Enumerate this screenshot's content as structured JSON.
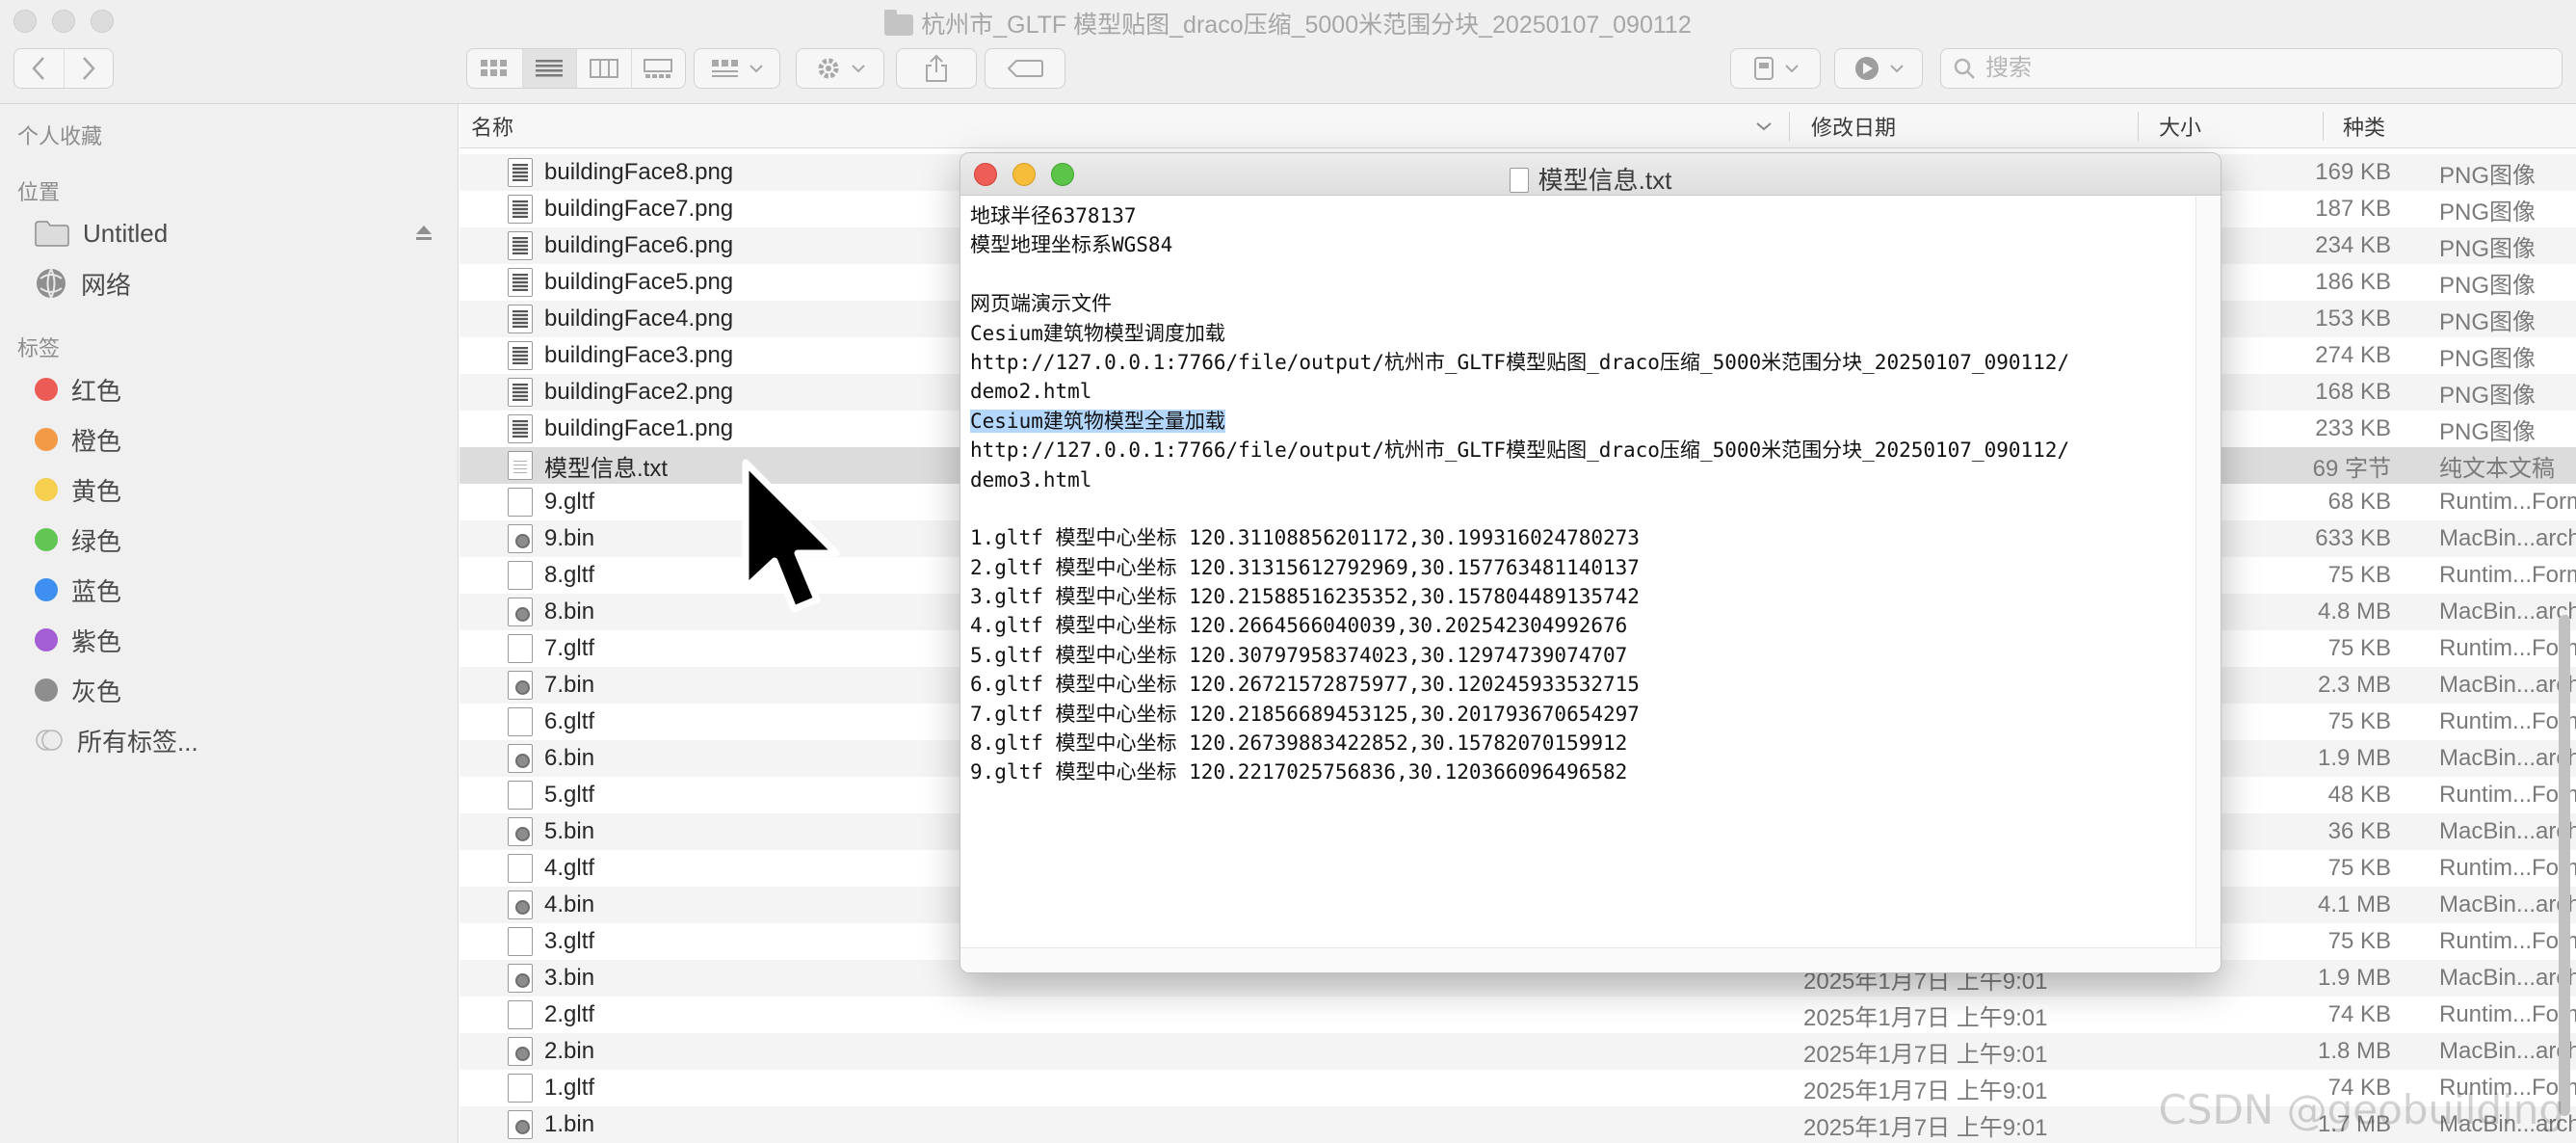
{
  "window": {
    "title": "杭州市_GLTF 模型贴图_draco压缩_5000米范围分块_20250107_090112"
  },
  "toolbar": {
    "search_placeholder": "搜索",
    "icons": [
      "back-icon",
      "forward-icon",
      "icon-view-icon",
      "list-view-icon",
      "column-view-icon",
      "gallery-view-icon",
      "group-icon",
      "gear-icon",
      "share-icon",
      "tag-icon",
      "device-icon",
      "quicklook-icon",
      "search-icon"
    ]
  },
  "sidebar": {
    "favorites_header": "个人收藏",
    "locations_header": "位置",
    "locations": [
      {
        "label": "Untitled",
        "icon": "folder-icon"
      },
      {
        "label": "网络",
        "icon": "network-icon"
      }
    ],
    "tags_header": "标签",
    "tags": [
      {
        "label": "红色",
        "color": "#ec5b55"
      },
      {
        "label": "橙色",
        "color": "#f29a46"
      },
      {
        "label": "黄色",
        "color": "#f6cf4f"
      },
      {
        "label": "绿色",
        "color": "#62c554"
      },
      {
        "label": "蓝色",
        "color": "#3f8ff0"
      },
      {
        "label": "紫色",
        "color": "#a55fd6"
      },
      {
        "label": "灰色",
        "color": "#8e8e8e"
      }
    ],
    "all_tags": "所有标签..."
  },
  "columns": {
    "name": "名称",
    "date": "修改日期",
    "size": "大小",
    "kind": "种类"
  },
  "files": [
    {
      "name": "buildingFace8.png",
      "date": "",
      "size": "169 KB",
      "kind": "PNG图像",
      "type": "png"
    },
    {
      "name": "buildingFace7.png",
      "date": "",
      "size": "187 KB",
      "kind": "PNG图像",
      "type": "png"
    },
    {
      "name": "buildingFace6.png",
      "date": "",
      "size": "234 KB",
      "kind": "PNG图像",
      "type": "png"
    },
    {
      "name": "buildingFace5.png",
      "date": "",
      "size": "186 KB",
      "kind": "PNG图像",
      "type": "png"
    },
    {
      "name": "buildingFace4.png",
      "date": "",
      "size": "153 KB",
      "kind": "PNG图像",
      "type": "png"
    },
    {
      "name": "buildingFace3.png",
      "date": "",
      "size": "274 KB",
      "kind": "PNG图像",
      "type": "png"
    },
    {
      "name": "buildingFace2.png",
      "date": "",
      "size": "168 KB",
      "kind": "PNG图像",
      "type": "png"
    },
    {
      "name": "buildingFace1.png",
      "date": "",
      "size": "233 KB",
      "kind": "PNG图像",
      "type": "png"
    },
    {
      "name": "模型信息.txt",
      "date": "",
      "size": "69 字节",
      "kind": "纯文本文稿",
      "type": "txt",
      "selected": true
    },
    {
      "name": "9.gltf",
      "date": "",
      "size": "68 KB",
      "kind": "Runtim...Format",
      "type": "gltf"
    },
    {
      "name": "9.bin",
      "date": "",
      "size": "633 KB",
      "kind": "MacBin...archive",
      "type": "bin"
    },
    {
      "name": "8.gltf",
      "date": "",
      "size": "75 KB",
      "kind": "Runtim...Format",
      "type": "gltf"
    },
    {
      "name": "8.bin",
      "date": "",
      "size": "4.8 MB",
      "kind": "MacBin...archive",
      "type": "bin"
    },
    {
      "name": "7.gltf",
      "date": "",
      "size": "75 KB",
      "kind": "Runtim...Format",
      "type": "gltf"
    },
    {
      "name": "7.bin",
      "date": "",
      "size": "2.3 MB",
      "kind": "MacBin...archive",
      "type": "bin"
    },
    {
      "name": "6.gltf",
      "date": "",
      "size": "75 KB",
      "kind": "Runtim...Format",
      "type": "gltf"
    },
    {
      "name": "6.bin",
      "date": "",
      "size": "1.9 MB",
      "kind": "MacBin...archive",
      "type": "bin"
    },
    {
      "name": "5.gltf",
      "date": "",
      "size": "48 KB",
      "kind": "Runtim...Format",
      "type": "gltf"
    },
    {
      "name": "5.bin",
      "date": "",
      "size": "36 KB",
      "kind": "MacBin...archive",
      "type": "bin"
    },
    {
      "name": "4.gltf",
      "date": "",
      "size": "75 KB",
      "kind": "Runtim...Format",
      "type": "gltf"
    },
    {
      "name": "4.bin",
      "date": "",
      "size": "4.1 MB",
      "kind": "MacBin...archive",
      "type": "bin"
    },
    {
      "name": "3.gltf",
      "date": "",
      "size": "75 KB",
      "kind": "Runtim...Format",
      "type": "gltf"
    },
    {
      "name": "3.bin",
      "date": "2025年1月7日 上午9:01",
      "size": "1.9 MB",
      "kind": "MacBin...archive",
      "type": "bin"
    },
    {
      "name": "2.gltf",
      "date": "2025年1月7日 上午9:01",
      "size": "74 KB",
      "kind": "Runtim...Format",
      "type": "gltf"
    },
    {
      "name": "2.bin",
      "date": "2025年1月7日 上午9:01",
      "size": "1.8 MB",
      "kind": "MacBin...archive",
      "type": "bin"
    },
    {
      "name": "1.gltf",
      "date": "2025年1月7日 上午9:01",
      "size": "74 KB",
      "kind": "Runtim...Format",
      "type": "gltf"
    },
    {
      "name": "1.bin",
      "date": "2025年1月7日 上午9:01",
      "size": "1.7 MB",
      "kind": "MacBin...archive",
      "type": "bin"
    }
  ],
  "textedit": {
    "title": "模型信息.txt",
    "lines": [
      "地球半径6378137",
      "模型地理坐标系WGS84",
      "",
      "网页端演示文件",
      "Cesium建筑物模型调度加载",
      "http://127.0.0.1:7766/file/output/杭州市_GLTF模型贴图_draco压缩_5000米范围分块_20250107_090112/",
      "demo2.html",
      "Cesium建筑物模型全量加载",
      "http://127.0.0.1:7766/file/output/杭州市_GLTF模型贴图_draco压缩_5000米范围分块_20250107_090112/",
      "demo3.html",
      "",
      "1.gltf 模型中心坐标 120.31108856201172,30.199316024780273",
      "2.gltf 模型中心坐标 120.31315612792969,30.157763481140137",
      "3.gltf 模型中心坐标 120.21588516235352,30.157804489135742",
      "4.gltf 模型中心坐标 120.2664566040039,30.202542304992676",
      "5.gltf 模型中心坐标 120.30797958374023,30.12974739074707",
      "6.gltf 模型中心坐标 120.26721572875977,30.120245933532715",
      "7.gltf 模型中心坐标 120.21856689453125,30.201793670654297",
      "8.gltf 模型中心坐标 120.26739883422852,30.15782070159912",
      "9.gltf 模型中心坐标 120.2217025756836,30.120366096496582"
    ],
    "highlighted_line": 7
  },
  "watermark": "CSDN @geobuilding"
}
